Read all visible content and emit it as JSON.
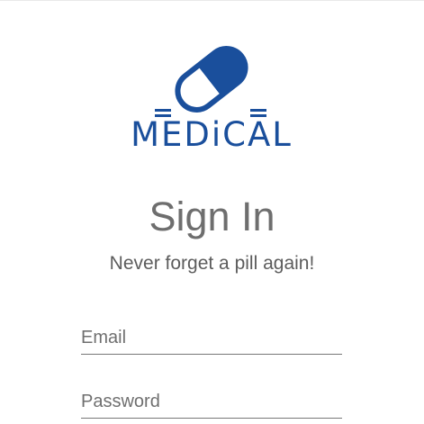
{
  "logo": {
    "icon": "pill-capsule-icon",
    "text": "MEDiCAL",
    "color": "#1a4f9c"
  },
  "signin": {
    "title": "Sign In",
    "subtitle": "Never forget a pill again!"
  },
  "form": {
    "email": {
      "placeholder": "Email",
      "value": ""
    },
    "password": {
      "placeholder": "Password",
      "value": ""
    }
  }
}
